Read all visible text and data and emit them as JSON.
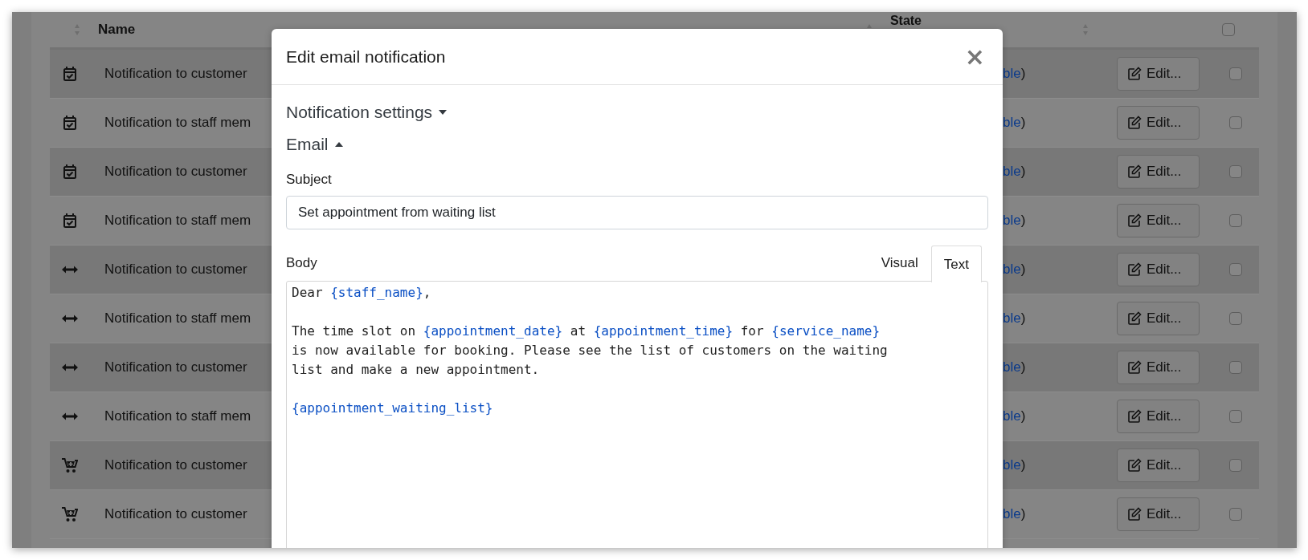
{
  "table": {
    "columns": [
      {
        "label": "Name"
      },
      {
        "label": "State"
      }
    ],
    "header_checkbox": {
      "checked": false
    },
    "rows": [
      {
        "kind": "calendar",
        "name": "Notification to customer",
        "state_link": "ble",
        "state_suffix": ")",
        "button": "Edit...",
        "checked": false
      },
      {
        "kind": "calendar",
        "name": "Notification to staff mem",
        "state_link": "ble",
        "state_suffix": ")",
        "button": "Edit...",
        "checked": false
      },
      {
        "kind": "calendar",
        "name": "Notification to customer",
        "state_link": "ble",
        "state_suffix": ")",
        "button": "Edit...",
        "checked": false
      },
      {
        "kind": "calendar",
        "name": "Notification to staff mem",
        "state_link": "ble",
        "state_suffix": ")",
        "button": "Edit...",
        "checked": false
      },
      {
        "kind": "arrows",
        "name": "Notification to customer",
        "state_link": "ble",
        "state_suffix": ")",
        "button": "Edit...",
        "checked": false
      },
      {
        "kind": "arrows",
        "name": "Notification to staff mem",
        "state_link": "ble",
        "state_suffix": ")",
        "button": "Edit...",
        "checked": false
      },
      {
        "kind": "arrows",
        "name": "Notification to customer",
        "state_link": "ble",
        "state_suffix": ")",
        "button": "Edit...",
        "checked": false
      },
      {
        "kind": "arrows",
        "name": "Notification to staff mem",
        "state_link": "ble",
        "state_suffix": ")",
        "button": "Edit...",
        "checked": false
      },
      {
        "kind": "cart",
        "name": "Notification to customer",
        "state_link": "ble",
        "state_suffix": ")",
        "button": "Edit...",
        "checked": false
      },
      {
        "kind": "cart",
        "name": "Notification to customer",
        "state_link": "ble",
        "state_suffix": ")",
        "button": "Edit...",
        "checked": false
      }
    ]
  },
  "modal": {
    "title": "Edit email notification",
    "close": "×",
    "sections": [
      {
        "label": "Notification settings",
        "expanded": false
      },
      {
        "label": "Email",
        "expanded": true
      }
    ],
    "subject": {
      "label": "Subject",
      "value": "Set appointment from waiting list"
    },
    "body": {
      "label": "Body",
      "tabs": [
        {
          "label": "Visual",
          "selected": false
        },
        {
          "label": "Text",
          "selected": true
        }
      ],
      "paragraphs": [
        [
          [
            {
              "kind": "text",
              "text": "Dear "
            },
            {
              "kind": "code",
              "text": "{staff_name}"
            },
            {
              "kind": "text",
              "text": ","
            }
          ]
        ],
        [
          [
            {
              "kind": "text",
              "text": "The time slot on "
            },
            {
              "kind": "code",
              "text": "{appointment_date}"
            },
            {
              "kind": "text",
              "text": " at "
            },
            {
              "kind": "code",
              "text": "{appointment_time}"
            },
            {
              "kind": "text",
              "text": " for "
            },
            {
              "kind": "code",
              "text": "{service_name}"
            }
          ],
          [
            {
              "kind": "text",
              "text": "is now available for booking. Please see the list of customers on the waiting"
            }
          ],
          [
            {
              "kind": "text",
              "text": "list and make a new appointment."
            }
          ]
        ],
        [
          [
            {
              "kind": "code",
              "text": "{appointment_waiting_list}"
            }
          ]
        ]
      ]
    }
  }
}
